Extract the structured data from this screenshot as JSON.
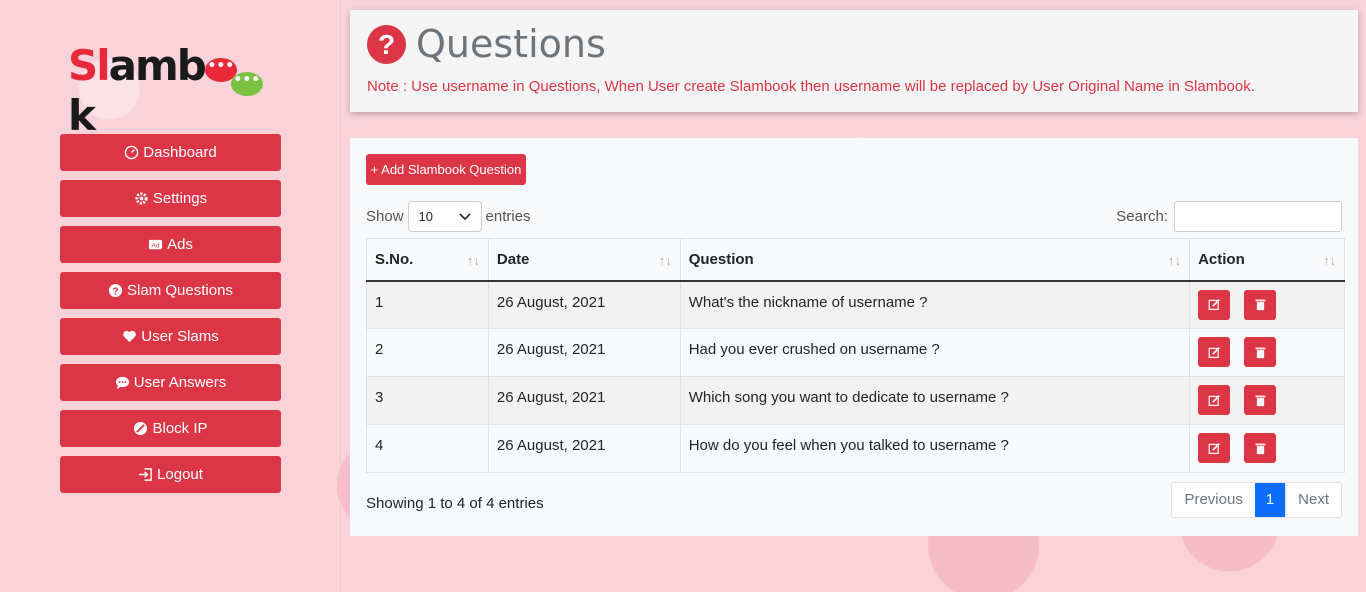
{
  "logo": {
    "part1": "Sl",
    "part2": "am",
    "part3": "b",
    "part4": "k",
    "bubble": "•••"
  },
  "nav": [
    {
      "label": "Dashboard",
      "icon": "gauge-icon"
    },
    {
      "label": "Settings",
      "icon": "gear-icon"
    },
    {
      "label": "Ads",
      "icon": "ad-icon"
    },
    {
      "label": "Slam Questions",
      "icon": "question-circle-icon"
    },
    {
      "label": "User Slams",
      "icon": "heart-icon"
    },
    {
      "label": "User Answers",
      "icon": "chat-icon"
    },
    {
      "label": "Block IP",
      "icon": "block-icon"
    },
    {
      "label": "Logout",
      "icon": "logout-icon"
    }
  ],
  "header": {
    "icon": "?",
    "title": "Questions",
    "note": "Note : Use username in Questions, When User create Slambook then username will be replaced by User Original Name in Slambook."
  },
  "toolbar": {
    "add_label": "+ Add Slambook Question",
    "show_label": "Show",
    "entries_value": "10",
    "entries_label": "entries",
    "search_label": "Search:"
  },
  "table": {
    "headers": [
      "S.No.",
      "Date",
      "Question",
      "Action"
    ],
    "sort_glyph": "↑↓",
    "rows": [
      {
        "sno": "1",
        "date": "26 August, 2021",
        "question": "What's the nickname of username ?"
      },
      {
        "sno": "2",
        "date": "26 August, 2021",
        "question": "Had you ever crushed on username ?"
      },
      {
        "sno": "3",
        "date": "26 August, 2021",
        "question": "Which song you want to dedicate to username ?"
      },
      {
        "sno": "4",
        "date": "26 August, 2021",
        "question": "How do you feel when you talked to username ?"
      }
    ]
  },
  "footer": {
    "info": "Showing 1 to 4 of 4 entries",
    "prev": "Previous",
    "page": "1",
    "next": "Next"
  },
  "colors": {
    "accent": "#dc3545",
    "primary": "#0d6efd"
  }
}
